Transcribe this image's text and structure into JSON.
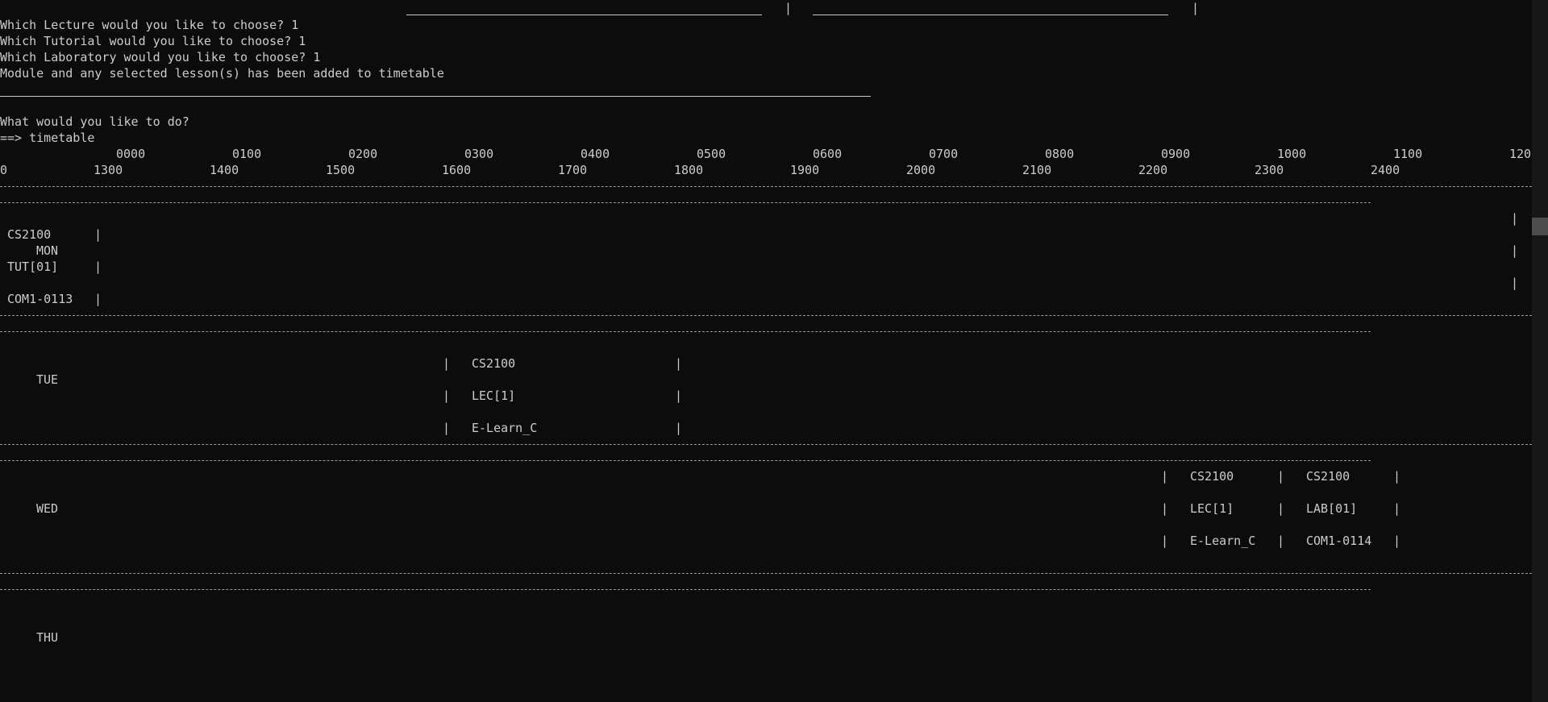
{
  "prompt_lines": [
    "Which Lecture would you like to choose? 1",
    "Which Tutorial would you like to choose? 1",
    "Which Laboratory would you like to choose? 1",
    "Module and any selected lesson(s) has been added to timetable"
  ],
  "question": "What would you like to do?",
  "command": "==> timetable",
  "pipe": "|",
  "header_row_1": [
    "0000",
    "0100",
    "0200",
    "0300",
    "0400",
    "0500",
    "0600",
    "0700",
    "0800",
    "0900",
    "1000",
    "1100",
    "120"
  ],
  "header_row_2": [
    "0",
    "1300",
    "1400",
    "1500",
    "1600",
    "1700",
    "1800",
    "1900",
    "2000",
    "2100",
    "2200",
    "2300",
    "2400"
  ],
  "days": {
    "mon": "MON",
    "tue": "TUE",
    "wed": "WED",
    "thu": "THU"
  },
  "mon_lesson": {
    "module": "CS2100",
    "type": "TUT[01]",
    "venue": "COM1-0113"
  },
  "tue_lesson": {
    "module": "CS2100",
    "type": "LEC[1]",
    "venue": "E-Learn_C"
  },
  "wed_lesson_1": {
    "module": "CS2100",
    "type": "LEC[1]",
    "venue": "E-Learn_C"
  },
  "wed_lesson_2": {
    "module": "CS2100",
    "type": "LAB[01]",
    "venue": "COM1-0114"
  }
}
